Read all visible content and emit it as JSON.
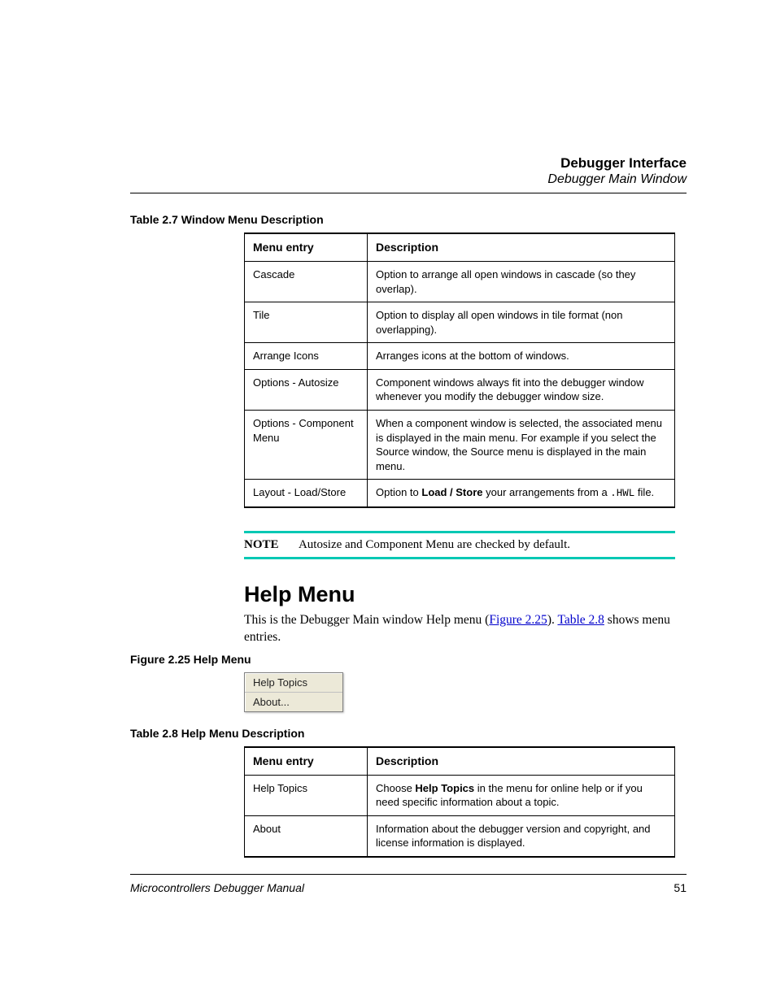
{
  "header": {
    "chapter": "Debugger Interface",
    "section": "Debugger Main Window"
  },
  "table27": {
    "caption": "Table 2.7  Window Menu Description",
    "head": {
      "c1": "Menu entry",
      "c2": "Description"
    },
    "rows": [
      {
        "entry": "Cascade",
        "desc": "Option to arrange all open windows in cascade (so they overlap)."
      },
      {
        "entry": "Tile",
        "desc": "Option to display all open windows in tile format (non overlapping)."
      },
      {
        "entry": "Arrange Icons",
        "desc": "Arranges icons at the bottom of windows."
      },
      {
        "entry": "Options - Autosize",
        "desc": "Component windows always fit into the debugger window whenever you modify the debugger window size."
      },
      {
        "entry": "Options - Component Menu",
        "desc": "When a component window is selected, the associated menu is displayed in the main menu. For example if you select the Source window, the Source menu is displayed in the main menu."
      }
    ],
    "lastRow": {
      "entry": "Layout - Load/Store",
      "pre": "Option to ",
      "bold": "Load / Store",
      "mid": " your arrangements from a ",
      "mono": ".HWL",
      "post": " file."
    }
  },
  "note": {
    "label": "NOTE",
    "text": "Autosize and Component Menu are checked by default."
  },
  "help": {
    "title": "Help Menu",
    "intro_pre": "This is the Debugger Main window Help menu (",
    "link1": "Figure 2.25",
    "intro_mid": "). ",
    "link2": "Table 2.8",
    "intro_post": " shows menu entries."
  },
  "figure225": {
    "caption": "Figure 2.25  Help Menu",
    "items": [
      "Help Topics",
      "About..."
    ]
  },
  "table28": {
    "caption": "Table 2.8   Help Menu Description",
    "head": {
      "c1": "Menu entry",
      "c2": "Description"
    },
    "rows": [
      {
        "entry": "About",
        "desc": "Information about the debugger version and copyright, and license information is displayed."
      }
    ],
    "firstRow": {
      "entry": "Help Topics",
      "pre": "Choose ",
      "bold": "Help Topics",
      "post": " in the menu for online help or if you need specific information about a topic."
    }
  },
  "footer": {
    "manual": "Microcontrollers Debugger Manual",
    "page": "51"
  }
}
